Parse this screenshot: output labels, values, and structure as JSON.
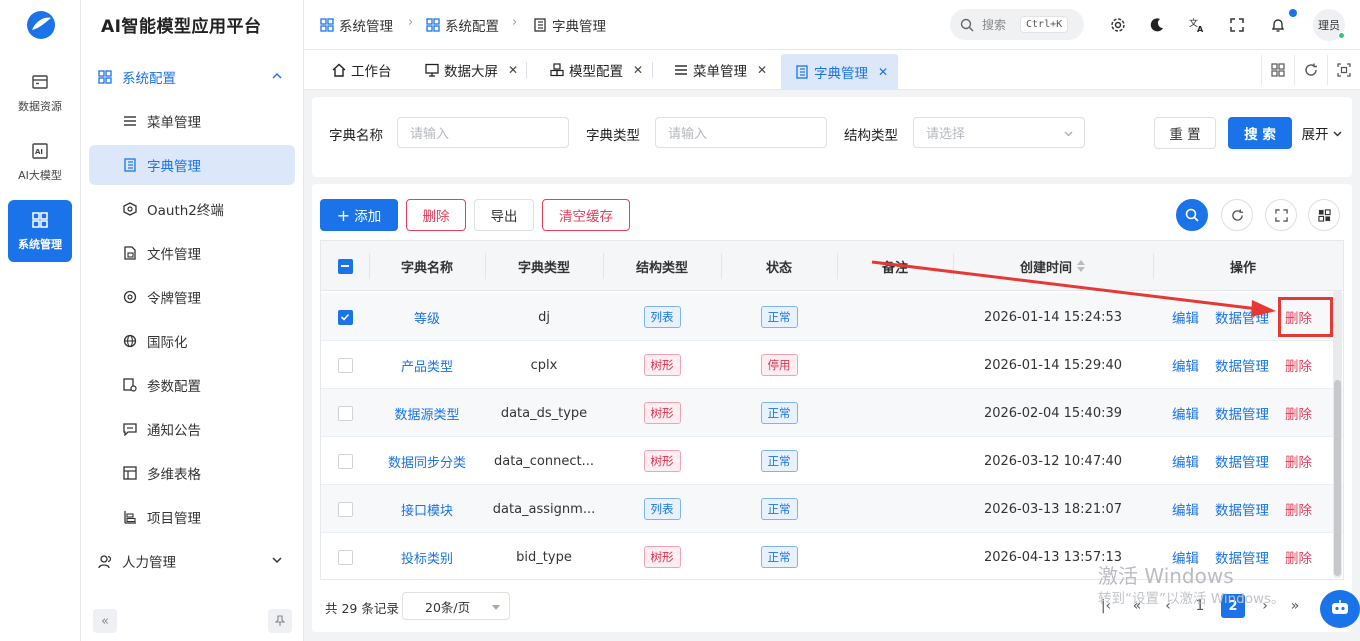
{
  "app": {
    "title": "AI智能模型应用平台"
  },
  "rail": {
    "items": [
      {
        "label": "数据资源",
        "icon": "database-icon"
      },
      {
        "label": "AI大模型",
        "icon": "ai-icon"
      },
      {
        "label": "系统管理",
        "icon": "system-grid-icon"
      }
    ]
  },
  "sidebar": {
    "group_open": {
      "label": "系统配置"
    },
    "items": [
      {
        "label": "菜单管理"
      },
      {
        "label": "字典管理"
      },
      {
        "label": "Oauth2终端"
      },
      {
        "label": "文件管理"
      },
      {
        "label": "令牌管理"
      },
      {
        "label": "国际化"
      },
      {
        "label": "参数配置"
      },
      {
        "label": "通知公告"
      },
      {
        "label": "多维表格"
      },
      {
        "label": "项目管理"
      }
    ],
    "group_closed": {
      "label": "人力管理"
    },
    "collapse": "«"
  },
  "breadcrumb": [
    "系统管理",
    "系统配置",
    "字典管理"
  ],
  "header": {
    "search_placeholder": "搜索",
    "search_shortcut": "Ctrl+K",
    "user": "理员"
  },
  "tabs": [
    {
      "label": "工作台"
    },
    {
      "label": "数据大屏"
    },
    {
      "label": "模型配置"
    },
    {
      "label": "菜单管理"
    },
    {
      "label": "字典管理"
    }
  ],
  "filter": {
    "name_label": "字典名称",
    "name_placeholder": "请输入",
    "type_label": "字典类型",
    "type_placeholder": "请输入",
    "struct_label": "结构类型",
    "struct_placeholder": "请选择",
    "reset": "重 置",
    "search": "搜 索",
    "expand": "展开"
  },
  "toolbar": {
    "add": "添加",
    "delete": "删除",
    "export": "导出",
    "clear_cache": "清空缓存"
  },
  "table": {
    "columns": [
      "字典名称",
      "字典类型",
      "结构类型",
      "状态",
      "备注",
      "创建时间",
      "操作"
    ],
    "rows": [
      {
        "name": "等级",
        "type": "dj",
        "struct": "列表",
        "status": "正常",
        "remark": "",
        "created": "2026-01-14 15:24:53",
        "checked": true
      },
      {
        "name": "产品类型",
        "type": "cplx",
        "struct": "树形",
        "status": "停用",
        "remark": "",
        "created": "2026-01-14 15:29:40",
        "checked": false
      },
      {
        "name": "数据源类型",
        "type": "data_ds_type",
        "struct": "树形",
        "status": "正常",
        "remark": "",
        "created": "2026-02-04 15:40:39",
        "checked": false
      },
      {
        "name": "数据同步分类",
        "type": "data_connect...",
        "struct": "树形",
        "status": "正常",
        "remark": "",
        "created": "2026-03-12 10:47:40",
        "checked": false
      },
      {
        "name": "接口模块",
        "type": "data_assignm...",
        "struct": "列表",
        "status": "正常",
        "remark": "",
        "created": "2026-03-13 18:21:07",
        "checked": false
      },
      {
        "name": "投标类别",
        "type": "bid_type",
        "struct": "树形",
        "status": "正常",
        "remark": "",
        "created": "2026-04-13 13:57:13",
        "checked": false
      }
    ],
    "ops": {
      "edit": "编辑",
      "data": "数据管理",
      "delete": "删除"
    }
  },
  "pagination": {
    "total": "共 29 条记录",
    "page_size": "20条/页",
    "pages": [
      "1",
      "2"
    ],
    "current": "2"
  },
  "watermark": {
    "line1": "激活 Windows",
    "line2": "转到“设置”以激活 Windows。"
  },
  "colors": {
    "primary": "#1a73e8",
    "danger": "#e5405c",
    "annotation": "#e53935"
  }
}
